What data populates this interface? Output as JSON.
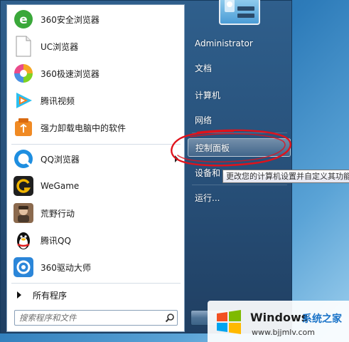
{
  "programs": [
    {
      "label": "360安全浏览器",
      "icon": "360-browser-icon"
    },
    {
      "label": "UC浏览器",
      "icon": "uc-browser-icon"
    },
    {
      "label": "360极速浏览器",
      "icon": "360-speed-browser-icon"
    },
    {
      "label": "腾讯视频",
      "icon": "tencent-video-icon"
    },
    {
      "label": "强力卸载电脑中的软件",
      "icon": "uninstall-tool-icon"
    },
    {
      "label": "QQ浏览器",
      "icon": "qq-browser-icon"
    },
    {
      "label": "WeGame",
      "icon": "wegame-icon"
    },
    {
      "label": "荒野行动",
      "icon": "knives-out-icon"
    },
    {
      "label": "腾讯QQ",
      "icon": "qq-penguin-icon"
    },
    {
      "label": "360驱动大师",
      "icon": "360-driver-icon"
    }
  ],
  "all_programs_label": "所有程序",
  "search": {
    "placeholder": "搜索程序和文件"
  },
  "right_items": {
    "user": "Administrator",
    "documents": "文档",
    "computer": "计算机",
    "network": "网络",
    "control_panel": "控制面板",
    "devices": "设备和",
    "run": "运行..."
  },
  "tooltip": "更改您的计算机设置并自定义其功能",
  "watermark": {
    "title": "Windows",
    "title2": "系统之家",
    "url": "www.bjjmlv.com"
  },
  "colors": {
    "highlight_circle": "#e0121b",
    "menu_blue": "#274f78"
  }
}
